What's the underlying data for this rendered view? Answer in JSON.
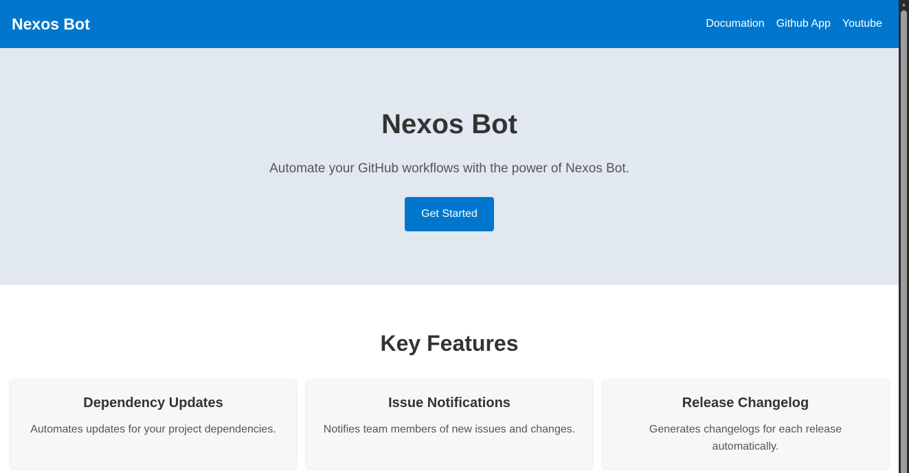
{
  "header": {
    "brand": "Nexos Bot",
    "links": [
      {
        "label": "Documation"
      },
      {
        "label": "Github App"
      },
      {
        "label": "Youtube"
      }
    ]
  },
  "hero": {
    "title": "Nexos Bot",
    "subtitle": "Automate your GitHub workflows with the power of Nexos Bot.",
    "cta_label": "Get Started"
  },
  "features": {
    "title": "Key Features",
    "cards": [
      {
        "title": "Dependency Updates",
        "description": "Automates updates for your project dependencies."
      },
      {
        "title": "Issue Notifications",
        "description": "Notifies team members of new issues and changes."
      },
      {
        "title": "Release Changelog",
        "description": "Generates changelogs for each release automatically."
      }
    ]
  },
  "scrollbar": {
    "up_arrow_icon": "chevron-up-icon"
  },
  "colors": {
    "brand_blue": "#0077cc",
    "hero_bg": "#e2e8f0",
    "card_bg": "#f7f7f7",
    "text_dark": "#333333"
  }
}
